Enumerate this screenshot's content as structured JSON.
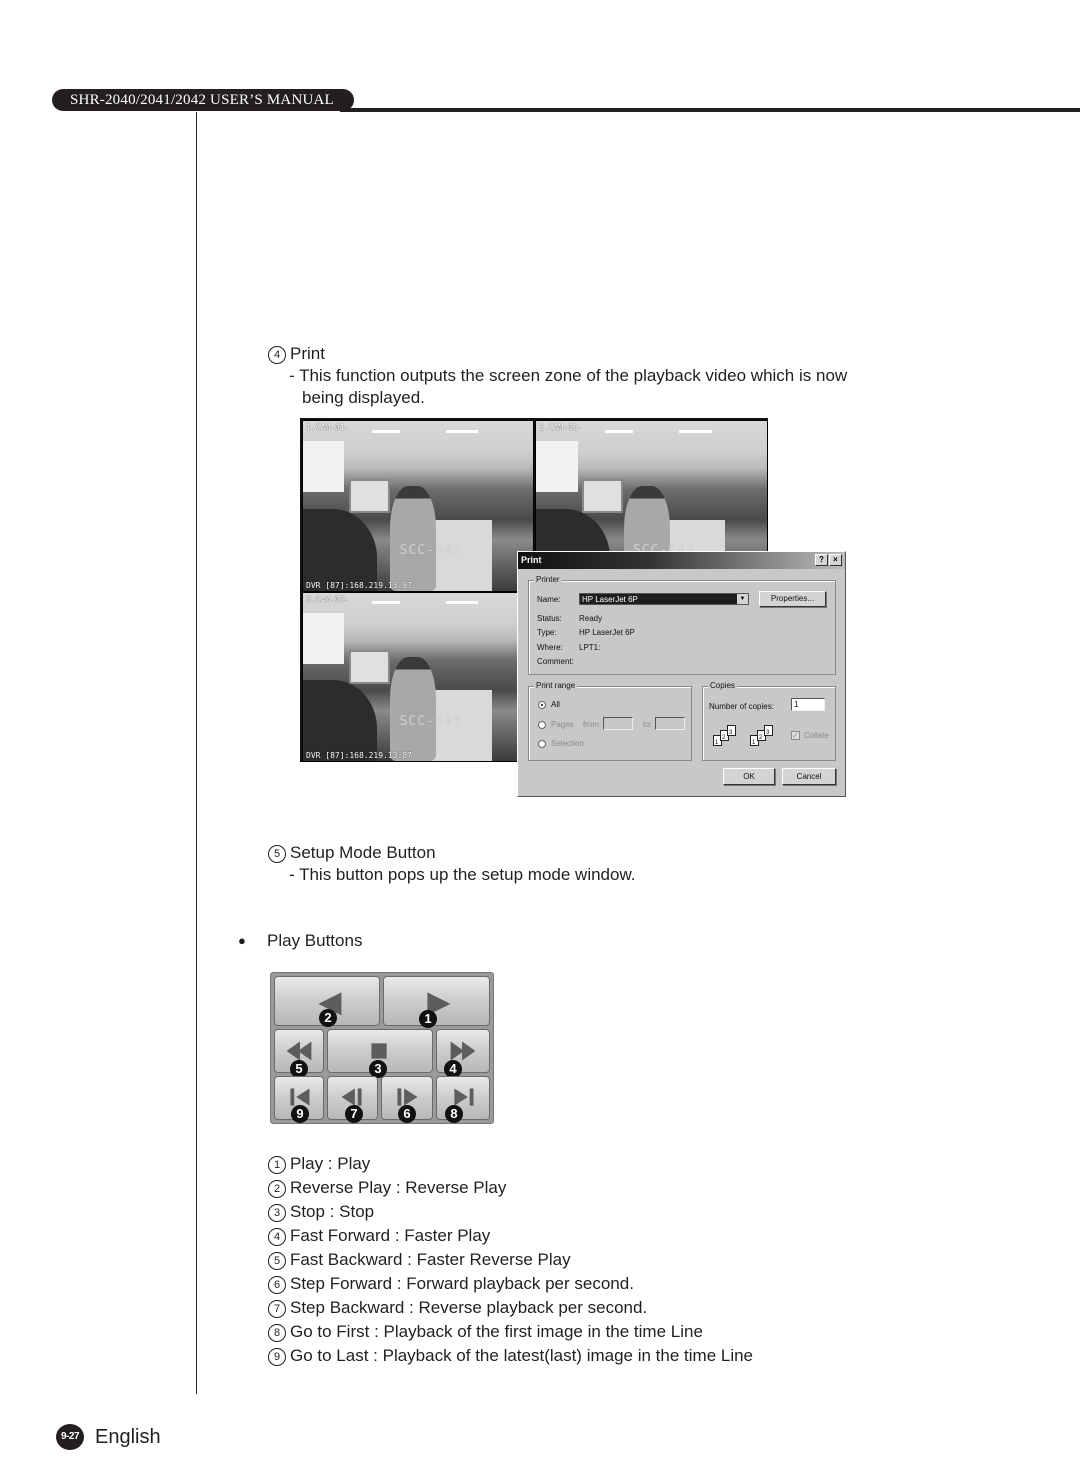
{
  "header": {
    "manual_title": "SHR-2040/2041/2042 USER’S MANUAL"
  },
  "sections": {
    "print": {
      "number": "4",
      "title": "Print",
      "description_line1": "- This function outputs the screen zone of the playback video which is now",
      "description_line2": "being displayed."
    },
    "setup": {
      "number": "5",
      "title": "Setup Mode Button",
      "description": "- This button pops up the setup mode window."
    },
    "play_buttons": {
      "bullet": "●",
      "title": "Play Buttons"
    }
  },
  "cameras": [
    {
      "id": "cam1",
      "label": "1.CAM-01-",
      "model": "SCC-643",
      "overlay": "DVR [87]:168.219.13.87"
    },
    {
      "id": "cam2",
      "label": "2.CAM-02-",
      "model": "SCC-643",
      "overlay": ""
    },
    {
      "id": "cam3",
      "label": "3.CAM-03-",
      "model": "SCC-643",
      "overlay": "DVR [87]:168.219.13.87"
    }
  ],
  "print_dialog": {
    "title": "Print",
    "help_btn": "?",
    "close_btn": "×",
    "printer_group": "Printer",
    "name_label": "Name:",
    "name_value": "HP LaserJet 6P",
    "properties_btn": "Properties...",
    "status_label": "Status:",
    "status_value": "Ready",
    "type_label": "Type:",
    "type_value": "HP LaserJet 6P",
    "where_label": "Where:",
    "where_value": "LPT1:",
    "comment_label": "Comment:",
    "comment_value": "",
    "range_group": "Print range",
    "range_all": "All",
    "range_pages": "Pages",
    "range_from": "from:",
    "range_to": "to:",
    "range_selection": "Selection",
    "range_selected": "All",
    "copies_group": "Copies",
    "copies_label": "Number of copies:",
    "copies_value": "1",
    "collate_label": "Collate",
    "collate_checked": true,
    "ok_btn": "OK",
    "cancel_btn": "Cancel",
    "page_nums": [
      "1",
      "2",
      "3"
    ]
  },
  "play_panel": {
    "buttons": [
      {
        "num": "2",
        "name": "reverse-play"
      },
      {
        "num": "1",
        "name": "play"
      },
      {
        "num": "5",
        "name": "fast-backward"
      },
      {
        "num": "3",
        "name": "stop"
      },
      {
        "num": "4",
        "name": "fast-forward"
      },
      {
        "num": "9",
        "name": "go-to-last"
      },
      {
        "num": "7",
        "name": "step-backward"
      },
      {
        "num": "6",
        "name": "step-forward"
      },
      {
        "num": "8",
        "name": "go-to-first"
      }
    ]
  },
  "legend": [
    {
      "num": "1",
      "text": "Play : Play"
    },
    {
      "num": "2",
      "text": "Reverse Play : Reverse Play"
    },
    {
      "num": "3",
      "text": "Stop : Stop"
    },
    {
      "num": "4",
      "text": "Fast Forward : Faster Play"
    },
    {
      "num": "5",
      "text": "Fast Backward : Faster Reverse Play"
    },
    {
      "num": "6",
      "text": "Step Forward : Forward playback per second."
    },
    {
      "num": "7",
      "text": "Step Backward : Reverse playback per second."
    },
    {
      "num": "8",
      "text": "Go to First : Playback of the first image in the time Line"
    },
    {
      "num": "9",
      "text": "Go to Last : Playback of the latest(last) image in the time Line"
    }
  ],
  "footer": {
    "page_number": "9-27",
    "language": "English"
  }
}
